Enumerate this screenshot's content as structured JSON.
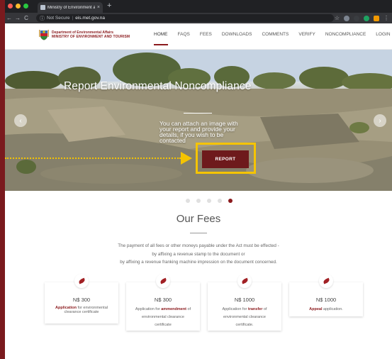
{
  "browser": {
    "tab_title": "Ministry of Environment and To",
    "tab_close": "×",
    "new_tab": "+",
    "nav": {
      "back": "←",
      "forward": "→",
      "reload": "C"
    },
    "omnibox": {
      "info_icon": "ⓘ",
      "security_label": "Not Secure",
      "separator": "|",
      "url": "eis.met.gov.na"
    },
    "colors": {
      "close": "#ff5f57",
      "minimize": "#febc2e",
      "maximize": "#28c840"
    }
  },
  "site": {
    "logo_line1": "Department of Environmental Affairs",
    "logo_line2": "MINISTRY OF ENVIRONMENT AND TOURISM",
    "nav": [
      {
        "label": "HOME",
        "active": true
      },
      {
        "label": "FAQS"
      },
      {
        "label": "FEES"
      },
      {
        "label": "DOWNLOADS"
      },
      {
        "label": "COMMENTS"
      },
      {
        "label": "VERIFY"
      },
      {
        "label": "NONCOMPLIANCE"
      },
      {
        "label": "LOGIN"
      }
    ],
    "accent": "#8b1a1d"
  },
  "hero": {
    "title": "Report Environmental Noncompliance",
    "subtitle": "You can attach an image with your report and provide your details, if you wish to be contacted",
    "button_label": "REPORT",
    "prev_arrow": "‹",
    "next_arrow": "›",
    "highlight_color": "#f5c400",
    "slide_count": 5,
    "active_slide": 5
  },
  "fees": {
    "title": "Our Fees",
    "intro_lines": [
      "The payment of all fees or other moneys payable under the Act must be effected -",
      "by affixing a revenue stamp to the document or",
      "by affixing a revenue franking machine impression on the document concerned."
    ],
    "cards": [
      {
        "amount": "N$ 300",
        "bold": "Application",
        "rest": " for environmental clearance certificate"
      },
      {
        "amount": "N$ 300",
        "pre": "Application for ",
        "bold": "ammendment",
        "rest": " of environmental clearance certificate"
      },
      {
        "amount": "N$ 1000",
        "pre": "Application for ",
        "bold": "transfer",
        "rest": " of environmental clearance certificate."
      },
      {
        "amount": "N$ 1000",
        "bold": "Appeal",
        "rest": " application."
      }
    ]
  }
}
